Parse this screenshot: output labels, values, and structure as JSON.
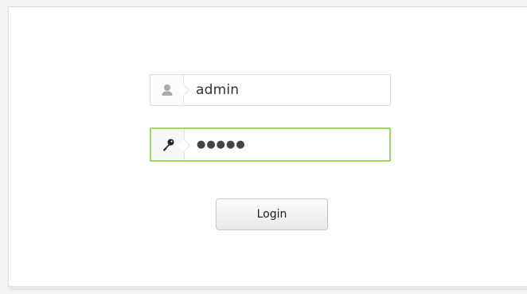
{
  "form": {
    "username": {
      "value": "admin",
      "icon": "user-icon"
    },
    "password": {
      "value": "●●●●●",
      "icon": "key-icon",
      "focus_color": "#9fd66a"
    },
    "login_label": "Login"
  }
}
